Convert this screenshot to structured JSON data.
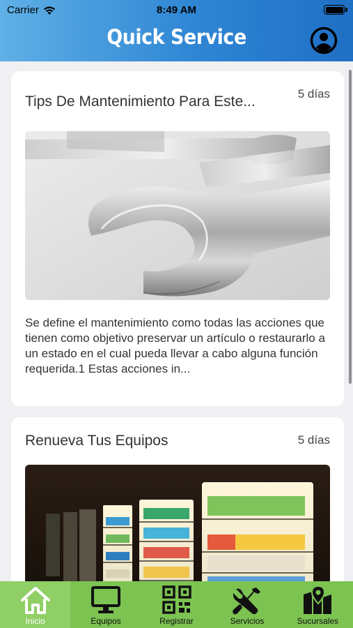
{
  "status_bar": {
    "carrier": "Carrier",
    "time": "8:49 AM"
  },
  "header": {
    "title": "Quick Service",
    "profile_icon": "user-circle-icon"
  },
  "posts": [
    {
      "title": "Tips De Mantenimiento Para Este...",
      "date": "5 días",
      "image": "wrenches-photo",
      "excerpt": "Se define el mantenimiento como todas las acciones que tienen como objetivo preservar un artículo o restaurarlo a un estado en el cual pueda llevar a cabo alguna función requerida.1 Estas acciones in..."
    },
    {
      "title": "Renueva Tus Equipos",
      "date": "5 días",
      "image": "refrigerators-photo",
      "excerpt": ""
    }
  ],
  "tabs": [
    {
      "label": "Inicio",
      "icon": "home-icon",
      "active": true
    },
    {
      "label": "Equipos",
      "icon": "monitor-icon",
      "active": false
    },
    {
      "label": "Registrar",
      "icon": "qr-code-icon",
      "active": false
    },
    {
      "label": "Servicios",
      "icon": "tools-icon",
      "active": false
    },
    {
      "label": "Sucursales",
      "icon": "map-icon",
      "active": false
    }
  ],
  "colors": {
    "header_start": "#5fb0e6",
    "header_end": "#1f6fc5",
    "tabbar": "#7cc352"
  }
}
